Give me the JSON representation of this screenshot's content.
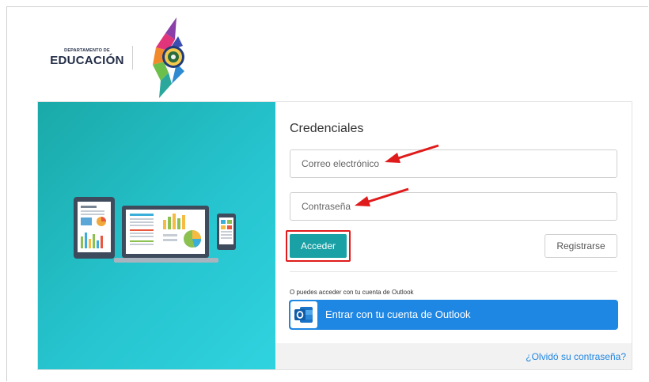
{
  "brand": {
    "department_line": "DEPARTAMENTO DE",
    "name_line": "EDUCACIÓN"
  },
  "login": {
    "title": "Credenciales",
    "email_placeholder": "Correo electrónico",
    "password_placeholder": "Contraseña",
    "submit_label": "Acceder",
    "register_label": "Registrarse",
    "outlook_note": "O puedes acceder con tu cuenta de Outlook",
    "outlook_button_label": "Entrar con tu cuenta de Outlook",
    "forgot_password_label": "¿Olvidó su contraseña?"
  },
  "icons": {
    "outlook": "outlook-icon",
    "hero": "devices-illustration",
    "emblem": "government-emblem"
  },
  "colors": {
    "accent_teal": "#1aa1a5",
    "outlook_blue": "#1e86e3",
    "annotation_red": "#e01b1b",
    "hero_gradient_start": "#1aa9a8",
    "hero_gradient_end": "#2fd3df"
  }
}
